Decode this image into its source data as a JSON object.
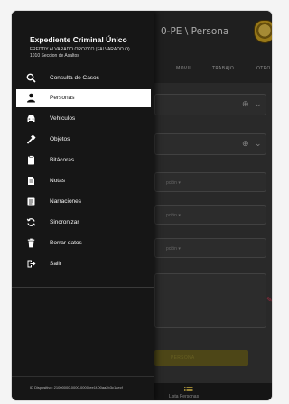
{
  "app": {
    "title": "0-PE \\ Persona",
    "tabs": [
      "MOVIL",
      "TRABAJO",
      "OTRO"
    ],
    "fields": [
      {
        "placeholder": "pción ▾"
      },
      {
        "placeholder": "pción ▾"
      },
      {
        "placeholder": "pción ▾"
      }
    ],
    "save_label": "PERSONA",
    "bottom_nav_label": "Lista Personas"
  },
  "drawer": {
    "title": "Expediente Criminal Único",
    "user_name": "FREDDY ALVARADO OROZCO (FALVARADO O)",
    "unit": "1010 Seccion de Asaltos",
    "items": [
      {
        "label": "Consulta de Casos",
        "icon": "search-icon",
        "active": false
      },
      {
        "label": "Personas",
        "icon": "person-icon",
        "active": true
      },
      {
        "label": "Vehículos",
        "icon": "car-icon",
        "active": false
      },
      {
        "label": "Objetos",
        "icon": "hammer-icon",
        "active": false
      },
      {
        "label": "Bitácoras",
        "icon": "clipboard-icon",
        "active": false
      },
      {
        "label": "Notas",
        "icon": "note-icon",
        "active": false
      },
      {
        "label": "Narraciones",
        "icon": "list-icon",
        "active": false
      },
      {
        "label": "Sincronizar",
        "icon": "sync-icon",
        "active": false
      },
      {
        "label": "Borrar datos",
        "icon": "trash-icon",
        "active": false
      },
      {
        "label": "Salir",
        "icon": "logout-icon",
        "active": false
      }
    ],
    "device_id": "ID Dispositivo: 21000000-0000-0000-ee1f-00aa2b3c1aecf"
  },
  "colors": {
    "drawer_bg": "#161616",
    "active_item_bg": "#ffffff",
    "accent_yellow": "#6b6220",
    "fab_pink": "#e03a57"
  }
}
